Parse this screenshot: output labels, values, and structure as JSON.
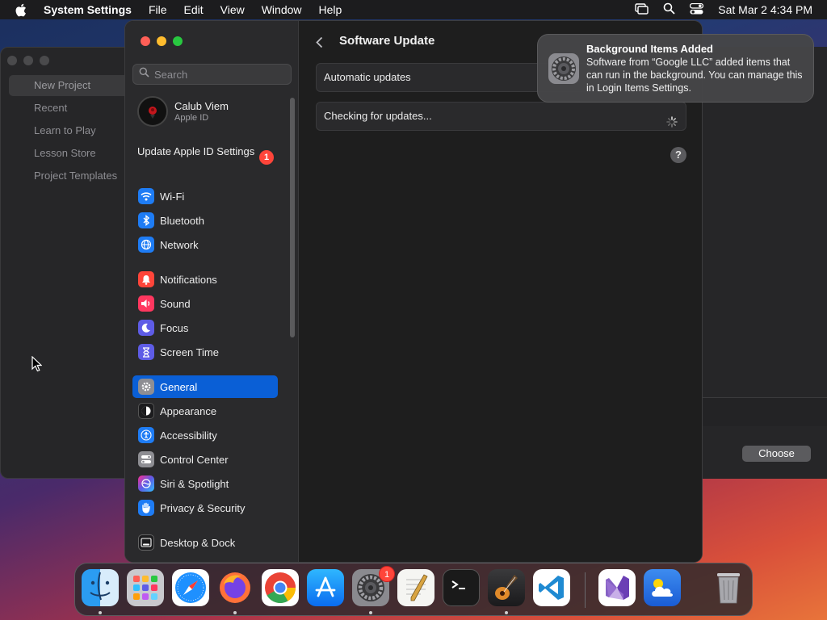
{
  "menubar": {
    "app_name": "System Settings",
    "menus": [
      "File",
      "Edit",
      "View",
      "Window",
      "Help"
    ],
    "datetime": "Sat Mar 2  4:34 PM"
  },
  "background_window": {
    "items": [
      "New Project",
      "Recent",
      "Learn to Play",
      "Lesson Store",
      "Project Templates"
    ],
    "selected": "New Project",
    "choose_label": "Choose"
  },
  "sidebar": {
    "search_placeholder": "Search",
    "profile": {
      "name": "Calub Viem",
      "subtitle": "Apple ID"
    },
    "update_apple_id": {
      "label": "Update Apple ID Settings",
      "badge": "1"
    },
    "groups": [
      [
        {
          "label": "Wi-Fi",
          "icon": "wifi-icon",
          "color": "#1e7cf5"
        },
        {
          "label": "Bluetooth",
          "icon": "bluetooth-icon",
          "color": "#1e7cf5"
        },
        {
          "label": "Network",
          "icon": "globe-icon",
          "color": "#1e7cf5"
        }
      ],
      [
        {
          "label": "Notifications",
          "icon": "bell-icon",
          "color": "#ff453a"
        },
        {
          "label": "Sound",
          "icon": "speaker-icon",
          "color": "#ff375f"
        },
        {
          "label": "Focus",
          "icon": "moon-icon",
          "color": "#5e5ce6"
        },
        {
          "label": "Screen Time",
          "icon": "hourglass-icon",
          "color": "#5e5ce6"
        }
      ],
      [
        {
          "label": "General",
          "icon": "gear-icon",
          "color": "#8e8e93",
          "selected": true
        },
        {
          "label": "Appearance",
          "icon": "appearance-icon",
          "color": "#1c1c1e"
        },
        {
          "label": "Accessibility",
          "icon": "accessibility-icon",
          "color": "#1e7cf5"
        },
        {
          "label": "Control Center",
          "icon": "control-center-icon",
          "color": "#8e8e93"
        },
        {
          "label": "Siri & Spotlight",
          "icon": "siri-icon",
          "color": "#bf5af2"
        },
        {
          "label": "Privacy & Security",
          "icon": "hand-icon",
          "color": "#1e7cf5"
        }
      ],
      [
        {
          "label": "Desktop & Dock",
          "icon": "dock-icon",
          "color": "#1c1c1e"
        }
      ]
    ]
  },
  "content": {
    "title": "Software Update",
    "automatic_updates": "Automatic updates",
    "checking": "Checking for updates...",
    "help": "?"
  },
  "notification": {
    "title": "Background Items Added",
    "body": "Software from “Google LLC” added items that can run in the background. You can manage this in Login Items Settings."
  },
  "dock": {
    "apps": [
      {
        "name": "Finder",
        "icon": "finder-icon",
        "running": true
      },
      {
        "name": "Launchpad",
        "icon": "launchpad-icon",
        "running": false
      },
      {
        "name": "Safari",
        "icon": "safari-icon",
        "running": false
      },
      {
        "name": "Firefox",
        "icon": "firefox-icon",
        "running": true
      },
      {
        "name": "Chrome",
        "icon": "chrome-icon",
        "running": false
      },
      {
        "name": "App Store",
        "icon": "app-store-icon",
        "running": false
      },
      {
        "name": "System Settings",
        "icon": "system-settings-icon",
        "running": true,
        "badge": "1"
      },
      {
        "name": "TextEdit",
        "icon": "textedit-icon",
        "running": false
      },
      {
        "name": "Terminal",
        "icon": "terminal-icon",
        "running": false
      },
      {
        "name": "GarageBand",
        "icon": "garageband-icon",
        "running": true
      },
      {
        "name": "VS Code",
        "icon": "vscode-icon",
        "running": false
      },
      {
        "name": "Visual Studio",
        "icon": "visual-studio-icon",
        "running": false
      },
      {
        "name": "Weather",
        "icon": "weather-icon",
        "running": false
      },
      {
        "name": "Trash",
        "icon": "trash-icon",
        "running": false
      }
    ]
  }
}
